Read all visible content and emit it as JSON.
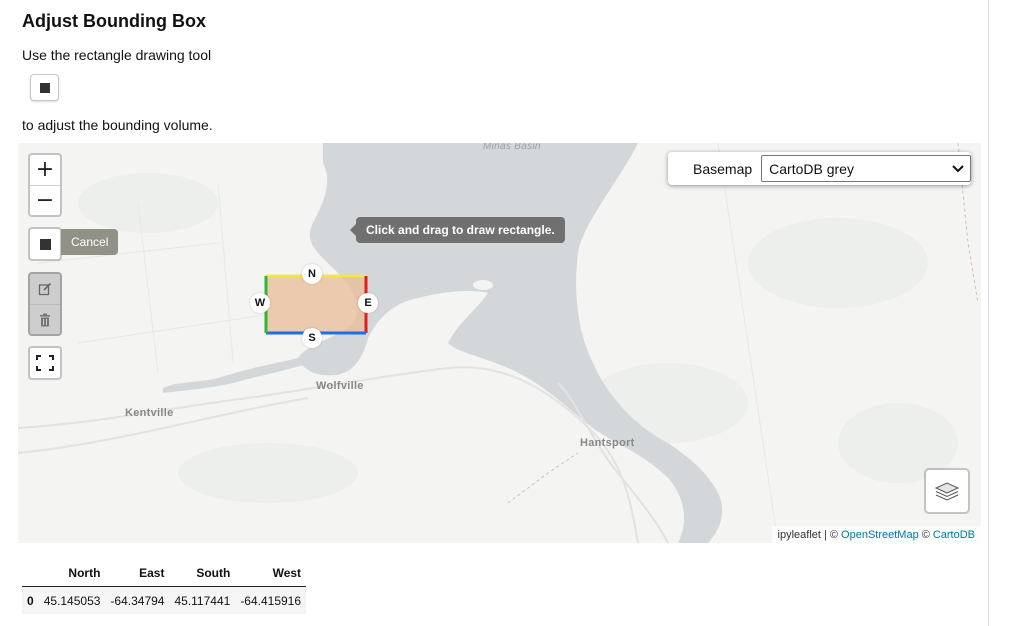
{
  "header": {
    "title": "Adjust Bounding Box",
    "instruction_before": "Use the rectangle drawing tool",
    "instruction_after": "to adjust the bounding volume."
  },
  "map": {
    "zoom_in_label": "+",
    "zoom_out_label": "−",
    "draw_cancel_label": "Cancel",
    "draw_tooltip": "Click and drag to draw rectangle.",
    "basemap_label": "Basemap",
    "basemap_selected": "CartoDB grey",
    "attribution": {
      "prefix": "ipyleaflet | ©",
      "osm": "OpenStreetMap",
      "sep": "©",
      "carto": "CartoDB"
    },
    "place_labels": {
      "minas_basin": "Minas Basin",
      "wolfville": "Wolfville",
      "kentville": "Kentville",
      "hantsport": "Hantsport"
    },
    "bbox_handles": {
      "north": "N",
      "east": "E",
      "south": "S",
      "west": "W"
    },
    "colors": {
      "water": "#d4d7da",
      "land": "#f4f4f2",
      "bbox_fill": "#e9bc95",
      "north_edge": "#f2e64a",
      "east_edge": "#e02020",
      "south_edge": "#1f6ee8",
      "west_edge": "#33b533",
      "accent_link": "#0078a8"
    },
    "icons": [
      "plus-icon",
      "minus-icon",
      "square-icon",
      "edit-icon",
      "trash-icon",
      "fullscreen-icon",
      "layers-icon",
      "chevron-down-icon"
    ]
  },
  "table": {
    "columns": [
      "",
      "North",
      "East",
      "South",
      "West"
    ],
    "rows": [
      {
        "index": "0",
        "north": "45.145053",
        "east": "-64.34794",
        "south": "45.117441",
        "west": "-64.415916"
      }
    ]
  }
}
